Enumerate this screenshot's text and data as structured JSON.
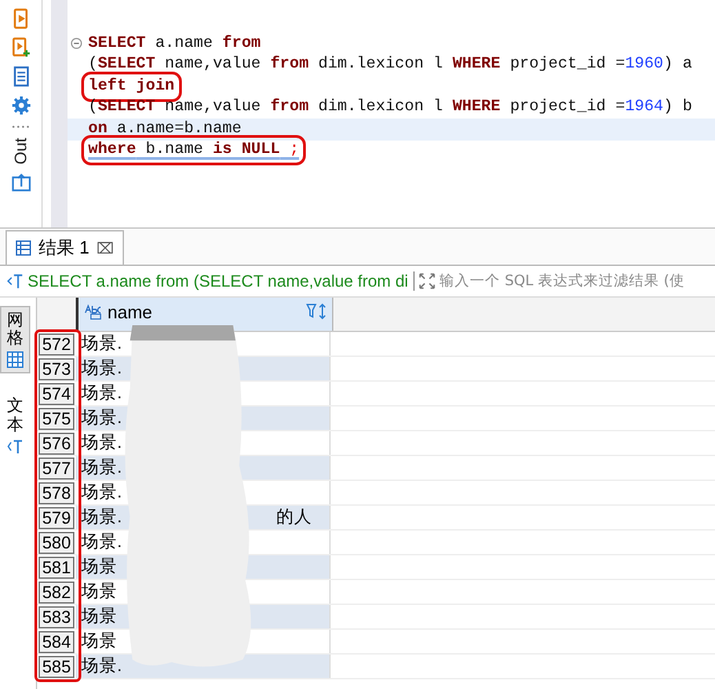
{
  "editor": {
    "side_toolbar": {
      "output_label": "Out"
    },
    "lines": [
      {
        "current": false,
        "boxed": false,
        "tokens": [
          {
            "t": "SELECT",
            "kind": "keyword"
          },
          {
            "t": " a.name ",
            "kind": "plain"
          },
          {
            "t": "from",
            "kind": "keyword"
          }
        ]
      },
      {
        "current": false,
        "boxed": false,
        "tokens": [
          {
            "t": "(",
            "kind": "plain"
          },
          {
            "t": "SELECT",
            "kind": "keyword"
          },
          {
            "t": " name,value ",
            "kind": "plain"
          },
          {
            "t": "from",
            "kind": "keyword"
          },
          {
            "t": " dim.lexicon l ",
            "kind": "plain"
          },
          {
            "t": "WHERE",
            "kind": "keyword"
          },
          {
            "t": " project_id =",
            "kind": "plain"
          },
          {
            "t": "1960",
            "kind": "number"
          },
          {
            "t": ") a",
            "kind": "plain"
          }
        ]
      },
      {
        "current": false,
        "boxed": true,
        "tokens": [
          {
            "t": "left join",
            "kind": "keyword"
          }
        ]
      },
      {
        "current": false,
        "boxed": false,
        "tokens": [
          {
            "t": "(",
            "kind": "plain"
          },
          {
            "t": "SELECT",
            "kind": "keyword"
          },
          {
            "t": " name,value ",
            "kind": "plain"
          },
          {
            "t": "from",
            "kind": "keyword"
          },
          {
            "t": " dim.lexicon l ",
            "kind": "plain"
          },
          {
            "t": "WHERE",
            "kind": "keyword"
          },
          {
            "t": " project_id =",
            "kind": "plain"
          },
          {
            "t": "1964",
            "kind": "number"
          },
          {
            "t": ") b",
            "kind": "plain"
          }
        ]
      },
      {
        "current": true,
        "boxed": false,
        "tokens": [
          {
            "t": "on",
            "kind": "keyword"
          },
          {
            "t": " a.name=b.name",
            "kind": "plain"
          }
        ]
      },
      {
        "current": false,
        "boxed": true,
        "tokens": [
          {
            "t": "where",
            "kind": "keyword"
          },
          {
            "t": " b.name ",
            "kind": "plain"
          },
          {
            "t": "is NULL",
            "kind": "keyword"
          },
          {
            "t": " ;",
            "kind": "error"
          }
        ]
      }
    ]
  },
  "results": {
    "tab": {
      "label": "结果 1",
      "close": "⌧",
      "selected": true
    },
    "query_text": "SELECT a.name from (SELECT name,value from di",
    "filter": {
      "placeholder": "输入一个 SQL 表达式来过滤结果 (使"
    },
    "view_tabs": [
      {
        "label": "网格",
        "selected": true
      },
      {
        "label": "文本",
        "selected": false
      }
    ],
    "column": "name",
    "rows": [
      {
        "num": "572",
        "value": "场景."
      },
      {
        "num": "573",
        "value": "场景."
      },
      {
        "num": "574",
        "value": "场景."
      },
      {
        "num": "575",
        "value": "场景."
      },
      {
        "num": "576",
        "value": "场景."
      },
      {
        "num": "577",
        "value": "场景."
      },
      {
        "num": "578",
        "value": "场景."
      },
      {
        "num": "579",
        "value": "场景.",
        "tail": "的人"
      },
      {
        "num": "580",
        "value": "场景."
      },
      {
        "num": "581",
        "value": "场景"
      },
      {
        "num": "582",
        "value": "场景"
      },
      {
        "num": "583",
        "value": "场景"
      },
      {
        "num": "584",
        "value": "场景"
      },
      {
        "num": "585",
        "value": "场景."
      }
    ],
    "row_numbers_highlighted": true
  }
}
